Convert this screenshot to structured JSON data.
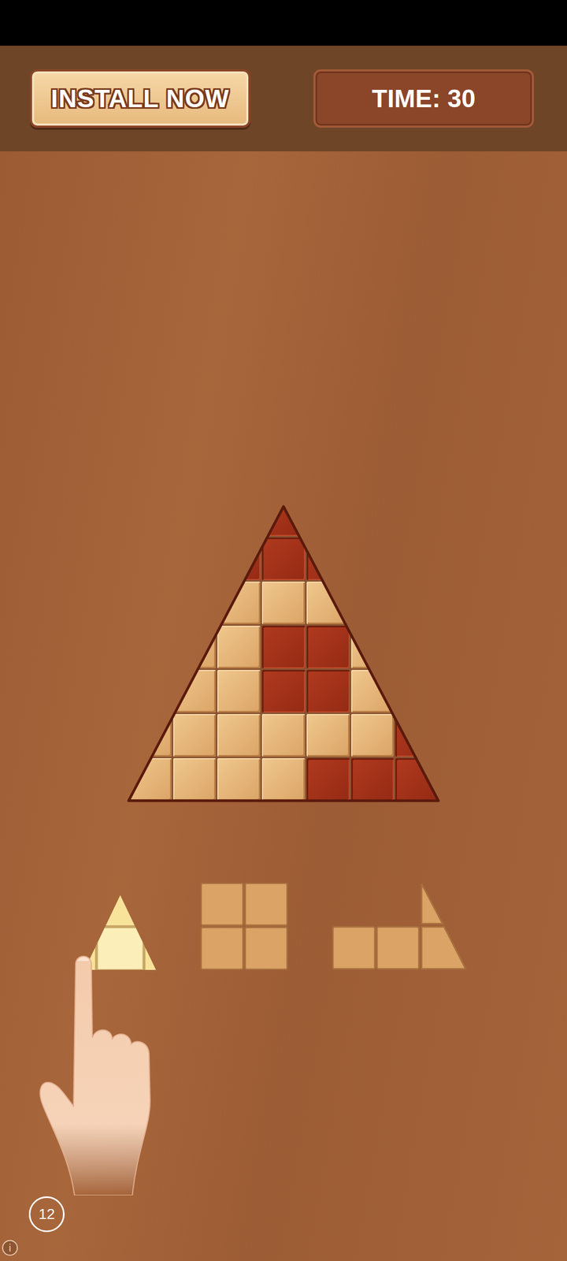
{
  "header": {
    "install_button": "INSTALL NOW",
    "timer": "TIME: 30"
  },
  "board": {
    "rows": [
      [
        {
          "filled": true
        },
        {
          "filled": true
        },
        {
          "filled": true
        },
        {
          "filled": false
        },
        {
          "filled": true
        },
        {
          "filled": true
        },
        {
          "filled": true
        }
      ],
      [
        {
          "filled": true
        },
        {
          "filled": true
        },
        {
          "filled": false
        },
        {
          "filled": false
        },
        {
          "filled": false
        },
        {
          "filled": true
        },
        {
          "filled": true
        }
      ],
      [
        {
          "filled": true
        },
        {
          "filled": true
        },
        {
          "filled": true
        },
        {
          "filled": true
        },
        {
          "filled": true
        },
        {
          "filled": true
        },
        {
          "filled": true
        }
      ],
      [
        {
          "filled": true
        },
        {
          "filled": true
        },
        {
          "filled": true
        },
        {
          "filled": false
        },
        {
          "filled": false
        },
        {
          "filled": true
        },
        {
          "filled": true
        }
      ],
      [
        {
          "filled": true
        },
        {
          "filled": true
        },
        {
          "filled": true
        },
        {
          "filled": false
        },
        {
          "filled": false
        },
        {
          "filled": true
        },
        {
          "filled": true
        }
      ],
      [
        {
          "filled": true
        },
        {
          "filled": true
        },
        {
          "filled": true
        },
        {
          "filled": true
        },
        {
          "filled": true
        },
        {
          "filled": true
        },
        {
          "filled": false
        }
      ],
      [
        {
          "filled": true
        },
        {
          "filled": true
        },
        {
          "filled": true
        },
        {
          "filled": true
        },
        {
          "filled": false
        },
        {
          "filled": false
        },
        {
          "filled": false
        }
      ]
    ]
  },
  "pieces": [
    {
      "kind": "triangle",
      "selected": true
    },
    {
      "kind": "square",
      "selected": false
    },
    {
      "kind": "corner",
      "selected": false
    }
  ],
  "level_badge": "12",
  "info": "i"
}
